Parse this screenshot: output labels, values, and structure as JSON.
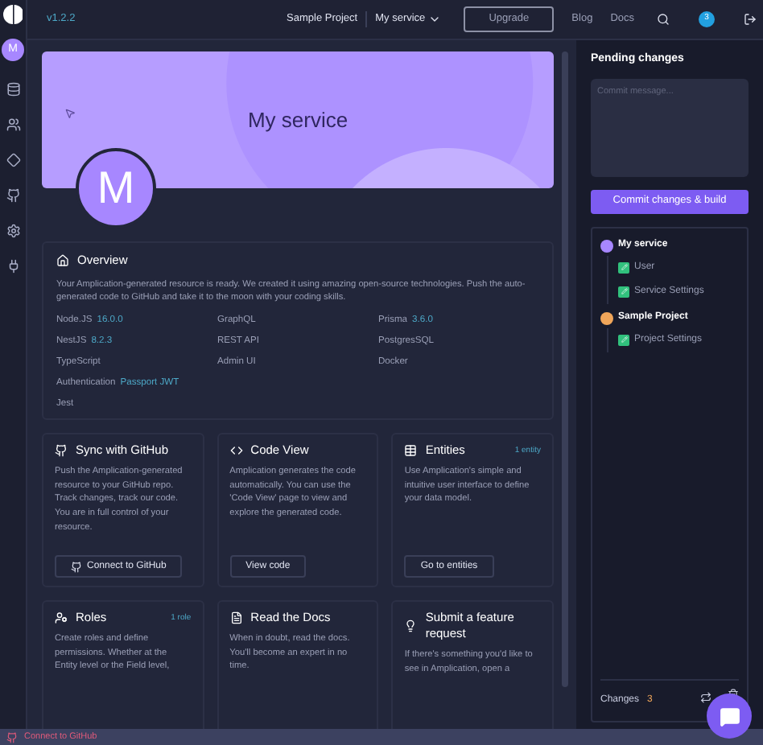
{
  "topbar": {
    "version": "v1.2.2",
    "project": "Sample Project",
    "service": "My service",
    "upgrade": "Upgrade",
    "links": [
      "Blog",
      "Docs"
    ],
    "notifications": "3"
  },
  "rail": {
    "avatar": "M",
    "items": [
      {
        "kind": "database"
      },
      {
        "kind": "users"
      },
      {
        "kind": "diamond"
      },
      {
        "kind": "github"
      },
      {
        "kind": "settings"
      },
      {
        "kind": "plug"
      }
    ]
  },
  "hero": {
    "title": "My service",
    "avatar": "M"
  },
  "overview": {
    "title": "Overview",
    "description": "Your Amplication-generated resource is ready. We created it using amazing open-source technologies. Push the auto-generated code to GitHub and take it to the moon with your coding skills.",
    "tech_rows": [
      [
        {
          "name": "Node.JS",
          "version": "16.0.0"
        },
        {
          "name": "GraphQL"
        },
        {
          "name": "Prisma",
          "version": "3.6.0"
        }
      ],
      [
        {
          "name": "NestJS",
          "version": "8.2.3"
        },
        {
          "name": "REST API"
        },
        {
          "name": "PostgresSQL"
        }
      ],
      [
        {
          "name": "TypeScript"
        },
        {
          "name": "Admin UI"
        },
        {
          "name": "Docker"
        }
      ],
      [
        {
          "name": "Authentication",
          "version": "Passport JWT"
        }
      ],
      [
        {
          "name": "Jest"
        }
      ]
    ]
  },
  "cards": [
    {
      "kind": "github",
      "title": "Sync with GitHub",
      "text": "Push the Amplication-generated resource to your GitHub repo. Track changes, track our code. You are in full control of your resource.",
      "button": "Connect to GitHub"
    },
    {
      "kind": "code",
      "title": "Code View",
      "text": "Amplication generates the code automatically. You can use the 'Code View' page to view and explore the generated code.",
      "button": "View code"
    },
    {
      "kind": "entities",
      "title": "Entities",
      "count": "1 entity",
      "text": "Use Amplication's simple and intuitive user interface to define your data model.",
      "button": "Go to entities"
    },
    {
      "kind": "roles",
      "title": "Roles",
      "count": "1 role",
      "text": "Create roles and define permissions. Whether at the Entity level or the Field level,"
    },
    {
      "kind": "docs",
      "title": "Read the Docs",
      "text": "When in doubt, read the docs. You'll become an expert in no time."
    },
    {
      "kind": "feature",
      "title": "Submit a feature request",
      "text": "If there's something you'd like to see in Amplication, open a"
    }
  ],
  "pending": {
    "title": "Pending changes",
    "placeholder": "Commit message...",
    "commit": "Commit changes & build",
    "groups": [
      {
        "kind": "service",
        "name": "My service",
        "children": [
          {
            "name": "User"
          },
          {
            "name": "Service Settings"
          }
        ]
      },
      {
        "kind": "project",
        "name": "Sample Project",
        "children": [
          {
            "name": "Project Settings"
          }
        ]
      }
    ],
    "changes_label": "Changes",
    "changes_count": "3"
  },
  "status_bar": {
    "text": "Connect to GitHub"
  }
}
